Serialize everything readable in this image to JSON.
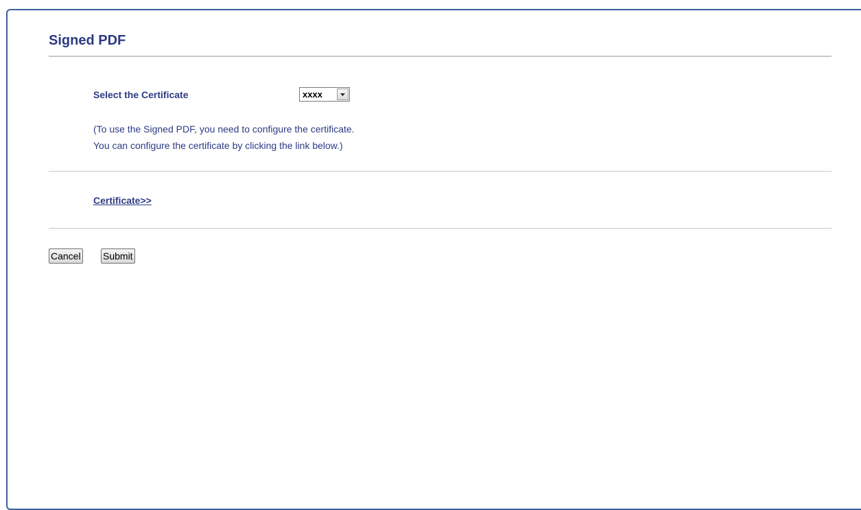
{
  "page": {
    "title": "Signed PDF"
  },
  "certificate_field": {
    "label": "Select the Certificate",
    "selected_value": "xxxx"
  },
  "info": {
    "line1": "(To use the Signed PDF, you need to configure the certificate.",
    "line2": "You can configure the certificate by clicking the link below.)"
  },
  "links": {
    "certificate": "Certificate>>"
  },
  "buttons": {
    "cancel": "Cancel",
    "submit": "Submit"
  },
  "colors": {
    "heading": "#2c3a82",
    "frame_border": "#3c5fa0",
    "divider": "#c8c8c8"
  }
}
